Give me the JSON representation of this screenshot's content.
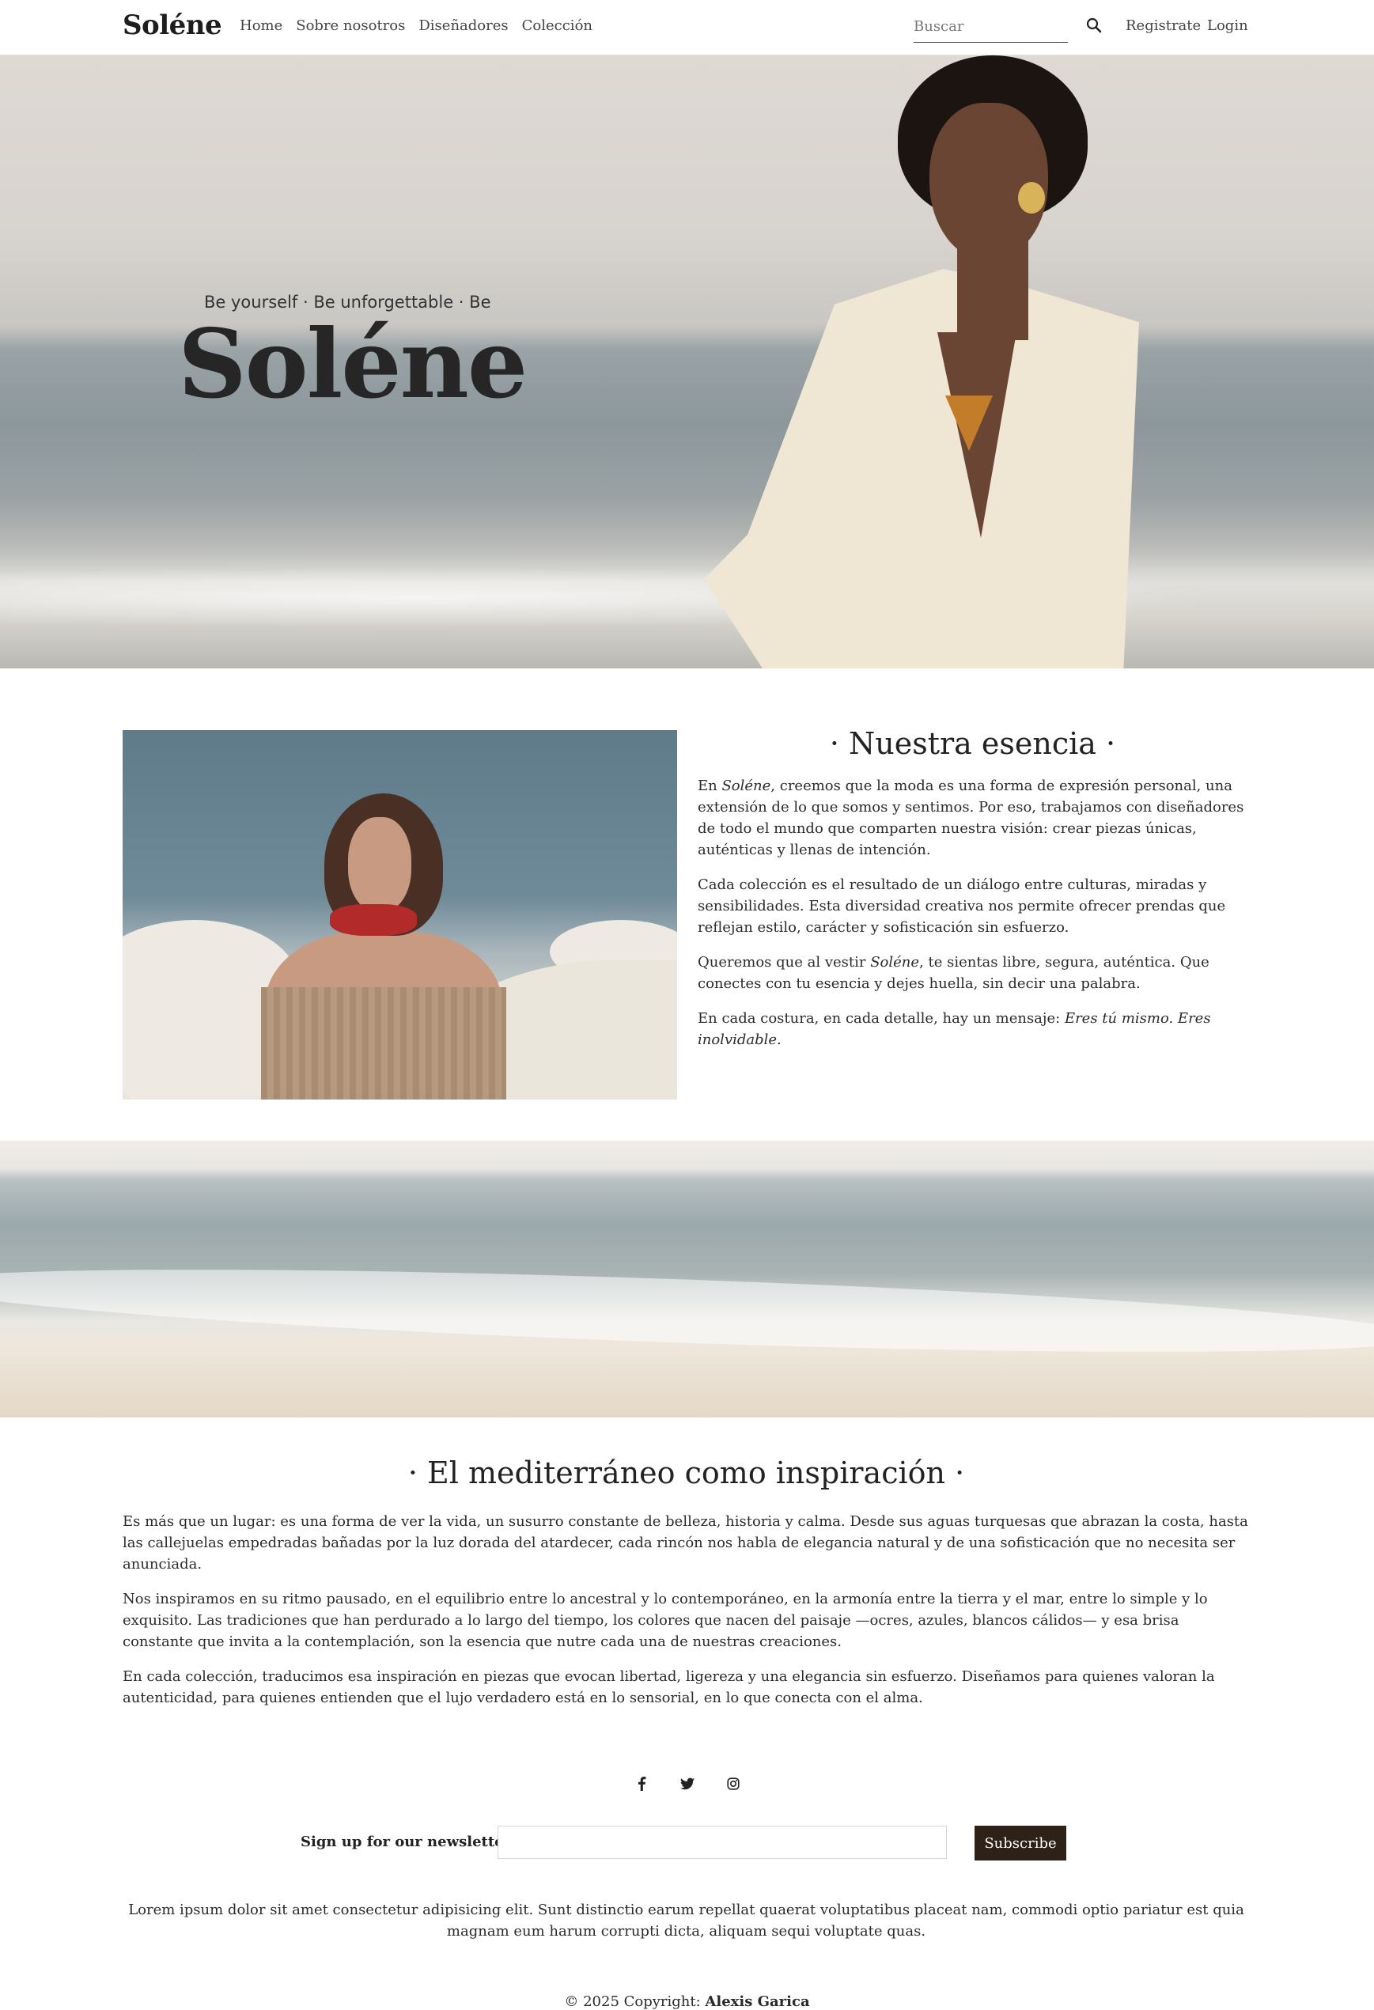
{
  "nav": {
    "logo": "Soléne",
    "menu": [
      "Home",
      "Sobre nosotros",
      "Diseñadores",
      "Colección"
    ],
    "search_placeholder": "Buscar",
    "register": "Registrate",
    "login": "Login"
  },
  "hero": {
    "tagline": "Be yourself · Be unforgettable · Be",
    "title": "Soléne"
  },
  "about": {
    "title": "· Nuestra esencia ·",
    "p1_before": "En ",
    "p1_em": "Soléne",
    "p1_after": ", creemos que la moda es una forma de expresión personal, una extensión de lo que somos y sentimos. Por eso, trabajamos con diseñadores de todo el mundo que comparten nuestra visión: crear piezas únicas, auténticas y llenas de intención.",
    "p2": "Cada colección es el resultado de un diálogo entre culturas, miradas y sensibilidades. Esta diversidad creativa nos permite ofrecer prendas que reflejan estilo, carácter y sofisticación sin esfuerzo.",
    "p3_before": "Queremos que al vestir ",
    "p3_em": "Soléne",
    "p3_after": ", te sientas libre, segura, auténtica. Que conectes con tu esencia y dejes huella, sin decir una palabra.",
    "p4_before": "En cada costura, en cada detalle, hay un mensaje: ",
    "p4_em": "Eres tú mismo. Eres inolvidable."
  },
  "inspiration": {
    "title": "· El mediterráneo como inspiración ·",
    "p1": "Es más que un lugar: es una forma de ver la vida, un susurro constante de belleza, historia y calma. Desde sus aguas turquesas que abrazan la costa, hasta las callejuelas empedradas bañadas por la luz dorada del atardecer, cada rincón nos habla de elegancia natural y de una sofisticación que no necesita ser anunciada.",
    "p2": "Nos inspiramos en su ritmo pausado, en el equilibrio entre lo ancestral y lo contemporáneo, en la armonía entre la tierra y el mar, entre lo simple y lo exquisito. Las tradiciones que han perdurado a lo largo del tiempo, los colores que nacen del paisaje —ocres, azules, blancos cálidos— y esa brisa constante que invita a la contemplación, son la esencia que nutre cada una de nuestras creaciones.",
    "p3": "En cada colección, traducimos esa inspiración en piezas que evocan libertad, ligereza y una elegancia sin esfuerzo. Diseñamos para quienes valoran la autenticidad, para quienes entienden que el lujo verdadero está en lo sensorial, en lo que conecta con el alma."
  },
  "footer": {
    "socials": [
      "facebook-icon",
      "twitter-icon",
      "instagram-icon"
    ],
    "newsletter_label": "Sign up for our newsletter",
    "newsletter_value": "",
    "subscribe": "Subscribe",
    "text": "Lorem ipsum dolor sit amet consectetur adipisicing elit. Sunt distinctio earum repellat quaerat voluptatibus placeat nam, commodi optio pariatur est quia magnam eum harum corrupti dicta, aliquam sequi voluptate quas.",
    "copyright_prefix": "© 2025 Copyright: ",
    "copyright_name": "Alexis Garica"
  },
  "colors": {
    "subscribe_bg": "#2e2218",
    "text": "#222222"
  }
}
